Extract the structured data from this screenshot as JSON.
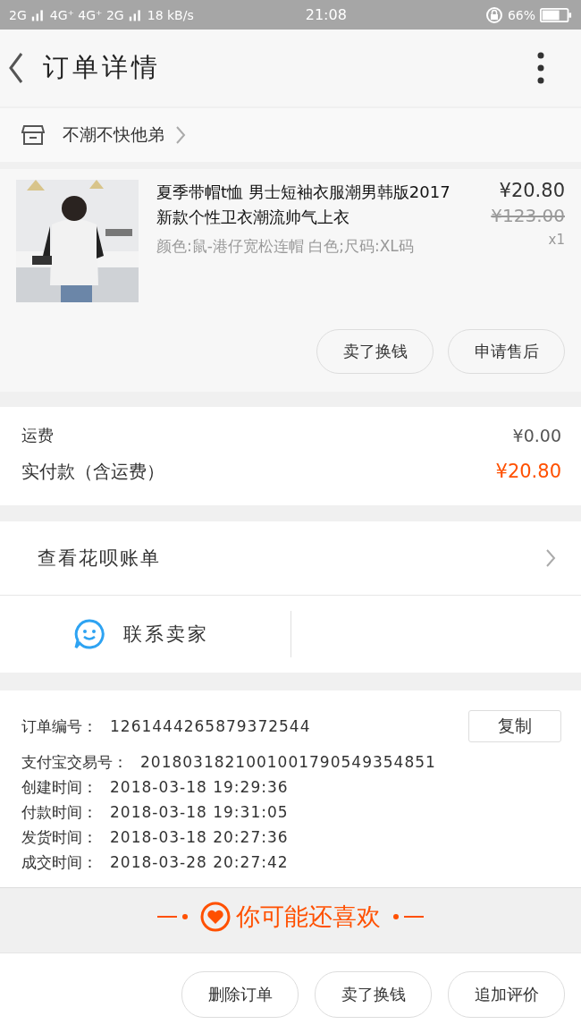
{
  "status_bar": {
    "signal_1": "2G",
    "signal_2": "4G⁺ 4G⁺ 2G",
    "speed": "18 kB/s",
    "time": "21:08",
    "battery": "66%"
  },
  "header": {
    "title": "订单详情"
  },
  "shop": {
    "name": "不潮不快他弟"
  },
  "product": {
    "kind": "picture",
    "title": "夏季带帽t恤 男士短袖衣服潮男韩版2017新款个性卫衣潮流帅气上衣",
    "spec": "颜色:鼠-港仔宽松连帽 白色;尺码:XL码",
    "price": "¥20.80",
    "original_price": "¥123.00",
    "quantity": "x1",
    "buttons": [
      "卖了换钱",
      "申请售后"
    ]
  },
  "fees": [
    {
      "label": "运费",
      "value": "¥0.00",
      "highlight": false
    },
    {
      "label": "实付款（含运费）",
      "value": "¥20.80",
      "highlight": true
    }
  ],
  "huabei": {
    "label": "查看花呗账单"
  },
  "contact": {
    "label": "联系卖家"
  },
  "order_info": {
    "copy_button": "复制",
    "rows": [
      {
        "label": "订单编号：",
        "value": "1261444265879372544"
      },
      {
        "label": "支付宝交易号：",
        "value": "2018031821001001790549354851"
      },
      {
        "label": "创建时间：",
        "value": "2018-03-18 19:29:36"
      },
      {
        "label": "付款时间：",
        "value": "2018-03-18 19:31:05"
      },
      {
        "label": "发货时间：",
        "value": "2018-03-18 20:27:36"
      },
      {
        "label": "成交时间：",
        "value": "2018-03-28 20:27:42"
      }
    ]
  },
  "recommend": {
    "title": "你可能还喜欢"
  },
  "bottom_buttons": [
    "删除订单",
    "卖了换钱",
    "追加评价"
  ]
}
